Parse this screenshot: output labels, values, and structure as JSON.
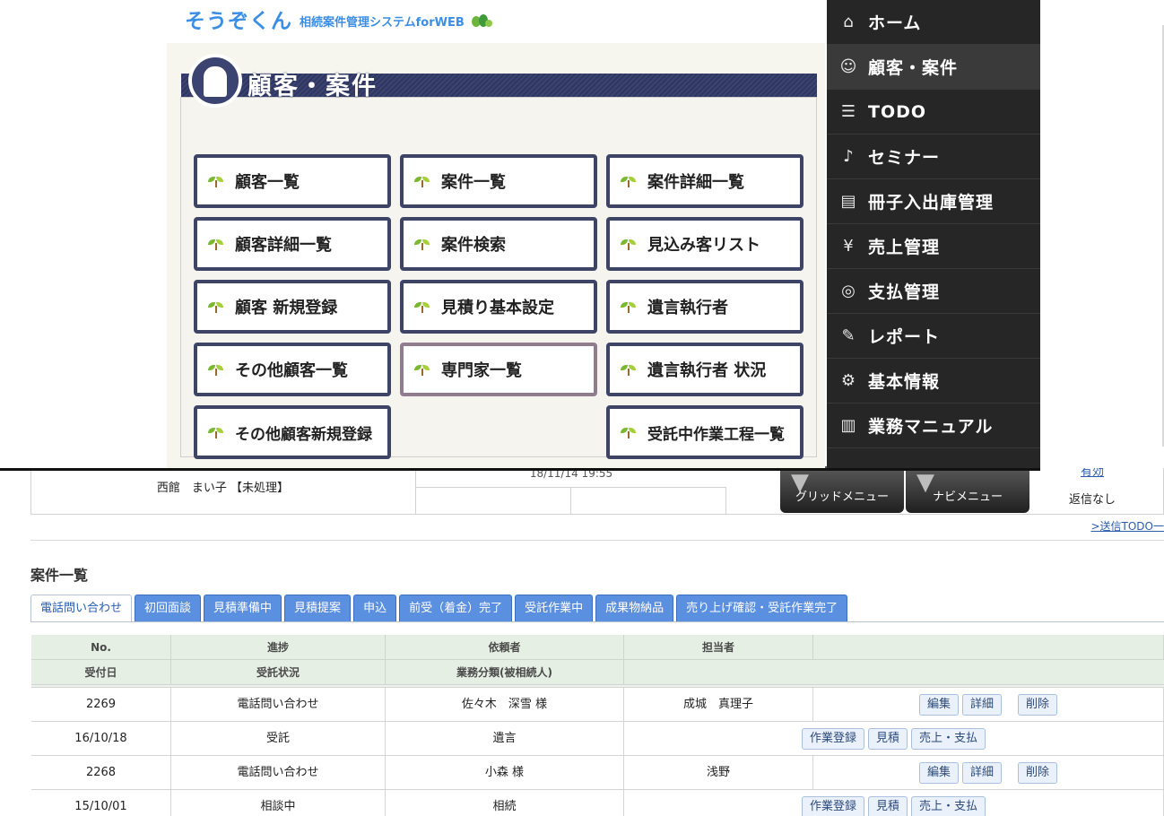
{
  "logo": {
    "main": "そうぞくん",
    "sub": "相続案件管理システムforWEB"
  },
  "panel": {
    "title": "顧客・案件"
  },
  "menu": [
    "顧客一覧",
    "案件一覧",
    "案件詳細一覧",
    "顧客詳細一覧",
    "案件検索",
    "見込み客リスト",
    "顧客 新規登録",
    "見積り基本設定",
    "遺言執行者",
    "その他顧客一覧",
    "専門家一覧",
    "遺言執行者 状況",
    "その他顧客新規登録",
    "受託中作業工程一覧"
  ],
  "sidenav": [
    {
      "label": "ホーム",
      "icon": "home-icon"
    },
    {
      "label": "顧客・案件",
      "icon": "customer-icon"
    },
    {
      "label": "TODO",
      "icon": "todo-icon"
    },
    {
      "label": "セミナー",
      "icon": "microphone-icon"
    },
    {
      "label": "冊子入出庫管理",
      "icon": "boxes-icon"
    },
    {
      "label": "売上管理",
      "icon": "yen-icon"
    },
    {
      "label": "支払管理",
      "icon": "coins-icon"
    },
    {
      "label": "レポート",
      "icon": "report-icon"
    },
    {
      "label": "基本情報",
      "icon": "gear-icon"
    },
    {
      "label": "業務マニュアル",
      "icon": "book-icon"
    }
  ],
  "background": {
    "prev_row": {
      "name": "西館　まい子 【未処理】",
      "datetime": "18/11/14 19:55",
      "link": "有効",
      "reply": "返信なし"
    },
    "grid_menu": "グリッドメニュー",
    "navi_menu": "ナビメニュー",
    "todo_link": ">送信TODO一",
    "section_title": "案件一覧",
    "tabs": [
      "電話問い合わせ",
      "初回面談",
      "見積準備中",
      "見積提案",
      "申込",
      "前受（着金）完了",
      "受託作業中",
      "成果物納品",
      "売り上げ確認・受託作業完了"
    ],
    "header1": [
      "No.",
      "進捗",
      "依頼者",
      "担当者",
      ""
    ],
    "header2": [
      "受付日",
      "受託状況",
      "業務分類(被相続人)",
      ""
    ],
    "rows": [
      {
        "no": "2269",
        "progress": "電話問い合わせ",
        "client": "佐々木　深雪 様",
        "staff": "成城　真理子",
        "date": "16/10/18",
        "status": "受託",
        "category": "遺言"
      },
      {
        "no": "2268",
        "progress": "電話問い合わせ",
        "client": "小森 様",
        "staff": "浅野",
        "date": "15/10/01",
        "status": "相談中",
        "category": "相続"
      }
    ],
    "buttons": {
      "edit": "編集",
      "detail": "詳細",
      "delete": "削除",
      "work": "作業登録",
      "estimate": "見積",
      "sales": "売上・支払"
    }
  }
}
